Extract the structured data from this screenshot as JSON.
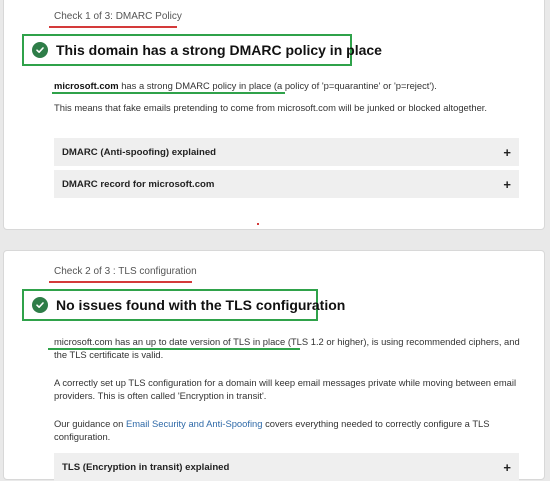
{
  "check1": {
    "step": "Check 1 of 3: DMARC Policy",
    "headline": "This domain has a strong DMARC policy in place",
    "domain": "microsoft.com",
    "policy_highlight": "has a strong DMARC policy in place",
    "policy_detail": "(a policy of 'p=quarantine' or 'p=reject').",
    "explanation": "This means that fake emails pretending to come from microsoft.com will be junked or blocked altogether.",
    "accordions": [
      {
        "title": "DMARC (Anti-spoofing) explained",
        "icon": "plus-icon"
      },
      {
        "title": "DMARC record for microsoft.com",
        "icon": "plus-icon"
      }
    ]
  },
  "check2": {
    "step": "Check 2 of 3 : TLS configuration",
    "headline": "No issues found with the TLS configuration",
    "tls_highlight": "microsoft.com has an up to date version of TLS in place",
    "tls_detail": "(TLS 1.2 or higher), is using recommended ciphers, and the TLS certificate is valid.",
    "explanation": "A correctly set up TLS configuration for a domain will keep email messages private while moving between email providers. This is often called 'Encryption in transit'.",
    "guidance_prefix": "Our guidance on",
    "guidance_link": "Email Security and Anti-Spoofing",
    "guidance_suffix": "covers everything needed to correctly configure a TLS configuration.",
    "accordions": [
      {
        "title": "TLS (Encryption in transit) explained",
        "icon": "plus-icon"
      }
    ]
  },
  "colors": {
    "success_green": "#2fa24a",
    "badge_green": "#2e7d48",
    "annotation_red": "#d43a3a",
    "link_blue": "#2f6aa8"
  }
}
